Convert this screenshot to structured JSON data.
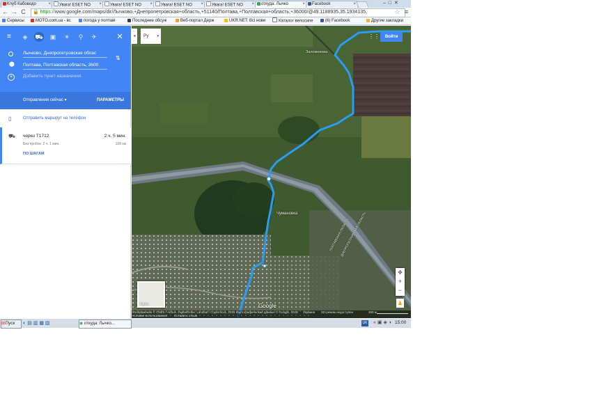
{
  "browser": {
    "tabs": [
      {
        "label": "Клуб Кабоводо",
        "color": "#c0392b"
      },
      {
        "label": "Увага! ESET NO",
        "color": "#ffffff"
      },
      {
        "label": "Увага! ESET NO",
        "color": "#ffffff"
      },
      {
        "label": "Увага! ESET NO",
        "color": "#ffffff"
      },
      {
        "label": "Увага! ESET NO",
        "color": "#ffffff"
      },
      {
        "label": "откуда: Лычко",
        "color": "#34a853"
      },
      {
        "label": "Facebook",
        "color": "#3b5998"
      }
    ],
    "url_https": "https://",
    "url_rest": "www.google.com/maps/dir/Лычково,+Днепропетровская+область,+51140/Полтава,+Полтавская+область,+36000/@49.1188935,35.1934135,",
    "bookmarks": [
      {
        "label": "Сервисы",
        "color": "#4285f4"
      },
      {
        "label": "MOTO.com.ua - вс",
        "color": "#c0392b"
      },
      {
        "label": "погода у полтаві",
        "color": "#4285f4"
      },
      {
        "label": "Последние обсуж",
        "color": "#2c3e50"
      },
      {
        "label": "Веб-портал Держ",
        "color": "#e8a33d"
      },
      {
        "label": "UKR.NET: Всі нови",
        "color": "#f1c40f"
      },
      {
        "label": "Каталог велосипе",
        "color": "#777777"
      },
      {
        "label": "(6) Facebook",
        "color": "#3b5998"
      },
      {
        "label": "Другие закладки",
        "color": "#e0b84a"
      }
    ]
  },
  "directions": {
    "origin": "Лычково, Днепропетровская облас",
    "destination": "Полтава, Полтавская область, 3600",
    "add_destination": "Добавить пункт назначения",
    "depart": "Отправления сейчас",
    "params": "ПАРАМЕТРЫ",
    "send_phone": "Отправить маршрут на телефон",
    "route_via": "через Т1712",
    "route_time": "2 ч. 5 мин.",
    "route_traffic": "Без пробок: 2 ч. 1 мин.",
    "route_distance": "108 км",
    "steps": "ПО ШАГАМ"
  },
  "map": {
    "language": "Ру",
    "signin": "Войти",
    "place_labels": [
      "Заломнянка",
      "Чумановка"
    ],
    "oblast_labels": [
      "ПОЛТАВСКАЯ ОБЛАСТЬ",
      "ДНЕПРОПЕТРОВСКАЯ ОБЛАСТЬ"
    ],
    "mini_label": "Карта",
    "logo": "Google",
    "attribution": "Изображения © CNES / Airbus, DigitalGlobe, Landsat / Copernicus, 2018 Картографические данные © Google, 2018",
    "country": "Украина",
    "mode3d": "3D-режим недоступен",
    "scale": "300 м",
    "terms": "Условия использования",
    "feedback": "Оставить отзыв"
  },
  "taskbar": {
    "start": "Пуск",
    "window": "откуда: Лычко...",
    "lang": "UK",
    "time": "15:00"
  },
  "colors": {
    "route": "#2b9cf2",
    "panel_header": "#4285f4",
    "panel_subbar": "#3a77dc",
    "link": "#3367d6"
  }
}
